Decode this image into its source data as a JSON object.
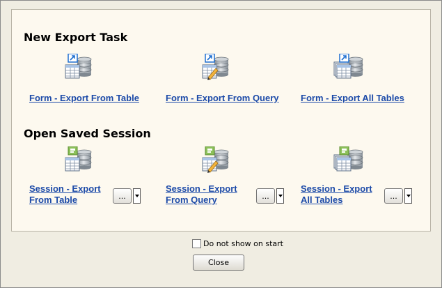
{
  "new_export": {
    "heading": "New Export Task",
    "tasks": [
      {
        "label": "Form - Export From Table",
        "icon": "export-table-icon"
      },
      {
        "label": "Form - Export From Query",
        "icon": "export-query-icon"
      },
      {
        "label": "Form - Export All Tables",
        "icon": "export-all-tables-icon"
      }
    ]
  },
  "saved_session": {
    "heading": "Open Saved Session",
    "tasks": [
      {
        "label": "Session - Export From Table",
        "button": "...",
        "icon": "session-table-icon"
      },
      {
        "label": "Session - Export From Query",
        "button": "...",
        "icon": "session-query-icon"
      },
      {
        "label": "Session - Export All Tables",
        "button": "...",
        "icon": "session-all-tables-icon"
      }
    ]
  },
  "footer": {
    "checkbox_label": "Do not show on start",
    "checkbox_checked": false,
    "close_label": "Close"
  },
  "colors": {
    "link": "#1c4aa8",
    "badge_new": "#1e6fd0",
    "badge_session": "#6aa43c",
    "database": "#9aa3ab"
  }
}
